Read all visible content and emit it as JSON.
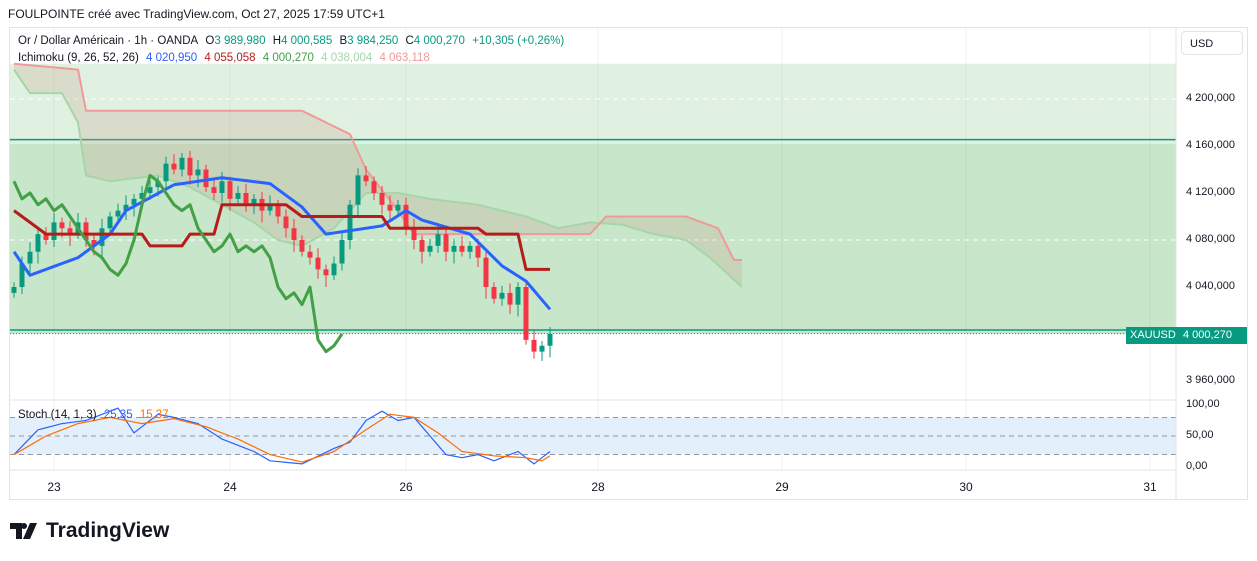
{
  "header": "FOULPOINTE créé avec TradingView.com, Oct 27, 2025 17:59 UTC+1",
  "legend": {
    "symbol": "Or / Dollar Américain · 1h · OANDA",
    "o_label": "O",
    "o": "3 989,980",
    "h_label": "H",
    "h": "4 000,585",
    "b_label": "B",
    "b": "3 984,250",
    "c_label": "C",
    "c": "4 000,270",
    "change": "+10,305 (+0,26%)"
  },
  "ichimoku": {
    "label": "Ichimoku (9, 26, 52, 26)",
    "tenkan": "4 020,950",
    "kijun": "4 055,058",
    "chikou": "4 000,270",
    "spanA": "4 038,004",
    "spanB": "4 063,118"
  },
  "stoch": {
    "label": "Stoch (14, 1, 3)",
    "k": "25,35",
    "d": "15,37"
  },
  "currency": "USD",
  "symbol_tag": "XAUUSD",
  "price_tag": "4 000,270",
  "logo": "TradingView",
  "colors": {
    "up": "#089981",
    "down": "#f23645",
    "tenkan": "#2962ff",
    "kijun": "#b71c1c",
    "chikou": "#43a047",
    "spanA": "#a5d6a7",
    "spanB": "#ef9a9a",
    "k": "#2962ff",
    "d": "#ff6d00"
  },
  "chart_data": {
    "type": "candlestick",
    "price_ticks": [
      "4 200,000",
      "4 160,000",
      "4 120,000",
      "4 080,000",
      "4 040,000",
      "3 960,000"
    ],
    "price_tick_values": [
      4200,
      4160,
      4120,
      4080,
      4040,
      3960
    ],
    "stoch_ticks": [
      "100,00",
      "50,00",
      "0,00"
    ],
    "stoch_tick_values": [
      100,
      50,
      0
    ],
    "time_ticks": [
      "23",
      "24",
      "26",
      "28",
      "29",
      "30",
      "31"
    ],
    "time_tick_index": [
      5,
      27,
      49,
      73,
      96,
      119,
      142
    ],
    "zones": [
      {
        "from": 4000,
        "to": 4162
      },
      {
        "from": 4162,
        "to": 4230
      }
    ],
    "closes": [
      4040,
      4060,
      4070,
      4085,
      4080,
      4095,
      4090,
      4085,
      4095,
      4080,
      4075,
      4090,
      4100,
      4105,
      4110,
      4115,
      4120,
      4125,
      4130,
      4145,
      4140,
      4150,
      4135,
      4140,
      4125,
      4120,
      4130,
      4115,
      4120,
      4110,
      4115,
      4105,
      4110,
      4100,
      4090,
      4080,
      4070,
      4065,
      4055,
      4050,
      4060,
      4080,
      4110,
      4135,
      4130,
      4120,
      4110,
      4105,
      4110,
      4090,
      4080,
      4070,
      4075,
      4085,
      4070,
      4075,
      4070,
      4075,
      4065,
      4040,
      4030,
      4035,
      4025,
      4040,
      3995,
      3985,
      3990,
      4000
    ],
    "tenkan": [
      [
        0,
        4070
      ],
      [
        2,
        4050
      ],
      [
        8,
        4065
      ],
      [
        12,
        4085
      ],
      [
        14,
        4105
      ],
      [
        20,
        4127
      ],
      [
        26,
        4133
      ],
      [
        32,
        4128
      ],
      [
        36,
        4108
      ],
      [
        39,
        4085
      ],
      [
        42,
        4088
      ],
      [
        46,
        4092
      ],
      [
        49,
        4105
      ],
      [
        51,
        4097
      ],
      [
        57,
        4085
      ],
      [
        61,
        4058
      ],
      [
        64,
        4045
      ],
      [
        67,
        4021
      ]
    ],
    "kijun": [
      [
        0,
        4105
      ],
      [
        4,
        4085
      ],
      [
        16,
        4085
      ],
      [
        17,
        4075
      ],
      [
        21,
        4075
      ],
      [
        22,
        4085
      ],
      [
        25,
        4085
      ],
      [
        26,
        4110
      ],
      [
        34,
        4110
      ],
      [
        36,
        4100
      ],
      [
        46,
        4100
      ],
      [
        47,
        4090
      ],
      [
        58,
        4090
      ],
      [
        59,
        4085
      ],
      [
        63,
        4085
      ],
      [
        64,
        4055
      ],
      [
        67,
        4055
      ]
    ],
    "spanA": [
      [
        0,
        4225
      ],
      [
        2,
        4205
      ],
      [
        6,
        4205
      ],
      [
        8,
        4180
      ],
      [
        9,
        4135
      ],
      [
        12,
        4130
      ],
      [
        18,
        4135
      ],
      [
        22,
        4125
      ],
      [
        26,
        4110
      ],
      [
        30,
        4095
      ],
      [
        33,
        4080
      ],
      [
        36,
        4075
      ],
      [
        40,
        4090
      ],
      [
        44,
        4120
      ],
      [
        48,
        4120
      ],
      [
        52,
        4115
      ],
      [
        58,
        4110
      ],
      [
        64,
        4100
      ],
      [
        68,
        4090
      ],
      [
        72,
        4095
      ],
      [
        76,
        4093
      ],
      [
        80,
        4085
      ],
      [
        84,
        4080
      ],
      [
        87,
        4065
      ],
      [
        91,
        4040
      ]
    ],
    "spanB": [
      [
        0,
        4230
      ],
      [
        8,
        4225
      ],
      [
        9,
        4190
      ],
      [
        36,
        4190
      ],
      [
        42,
        4170
      ],
      [
        44,
        4140
      ],
      [
        48,
        4105
      ],
      [
        50,
        4085
      ],
      [
        72,
        4085
      ],
      [
        74,
        4100
      ],
      [
        84,
        4100
      ],
      [
        88,
        4090
      ],
      [
        90,
        4063
      ],
      [
        91,
        4063
      ]
    ],
    "stochK": [
      [
        0,
        20
      ],
      [
        3,
        60
      ],
      [
        6,
        70
      ],
      [
        9,
        75
      ],
      [
        11,
        85
      ],
      [
        13,
        95
      ],
      [
        15,
        55
      ],
      [
        18,
        85
      ],
      [
        20,
        80
      ],
      [
        23,
        70
      ],
      [
        26,
        45
      ],
      [
        28,
        35
      ],
      [
        30,
        25
      ],
      [
        32,
        10
      ],
      [
        36,
        5
      ],
      [
        40,
        30
      ],
      [
        42,
        40
      ],
      [
        44,
        75
      ],
      [
        46,
        90
      ],
      [
        48,
        75
      ],
      [
        50,
        80
      ],
      [
        52,
        50
      ],
      [
        54,
        20
      ],
      [
        56,
        15
      ],
      [
        58,
        20
      ],
      [
        60,
        10
      ],
      [
        63,
        25
      ],
      [
        65,
        5
      ],
      [
        67,
        25
      ]
    ],
    "stochD": [
      [
        0,
        20
      ],
      [
        4,
        50
      ],
      [
        8,
        70
      ],
      [
        12,
        80
      ],
      [
        16,
        70
      ],
      [
        20,
        78
      ],
      [
        24,
        65
      ],
      [
        28,
        45
      ],
      [
        32,
        20
      ],
      [
        36,
        8
      ],
      [
        40,
        25
      ],
      [
        44,
        60
      ],
      [
        47,
        85
      ],
      [
        50,
        80
      ],
      [
        53,
        55
      ],
      [
        56,
        25
      ],
      [
        60,
        18
      ],
      [
        64,
        15
      ],
      [
        66,
        10
      ],
      [
        67,
        18
      ]
    ]
  }
}
